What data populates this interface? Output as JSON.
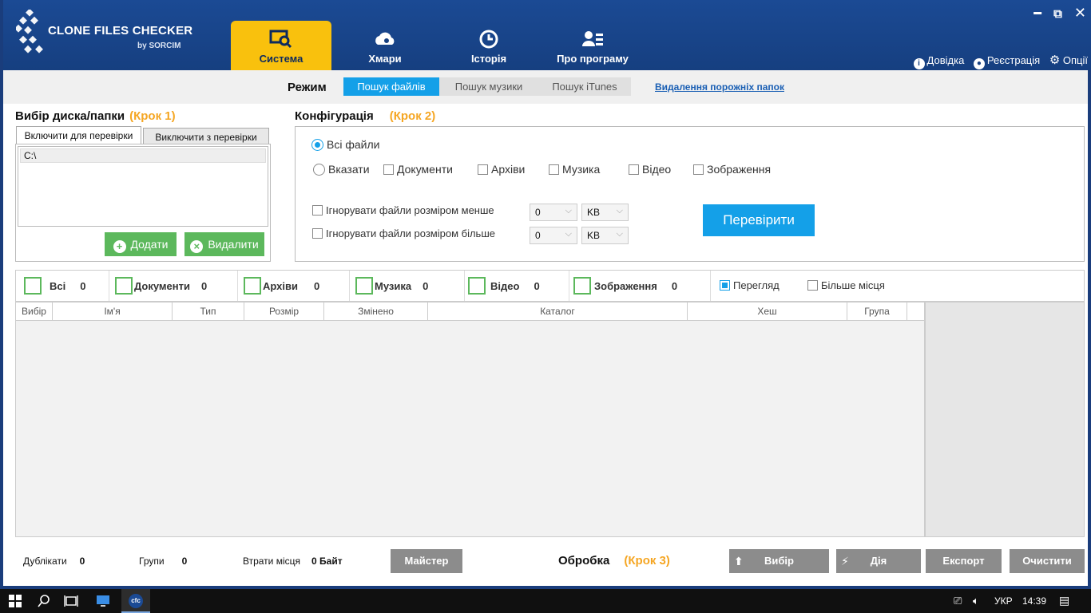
{
  "app": {
    "logo_title": "CLONE FILES CHECKER",
    "logo_sub": "by SORCIM"
  },
  "nav": [
    {
      "label": "Система",
      "icon": "search-drive-icon"
    },
    {
      "label": "Хмари",
      "icon": "cloud-search-icon"
    },
    {
      "label": "Історія",
      "icon": "history-icon"
    },
    {
      "label": "Про програму",
      "icon": "about-icon"
    }
  ],
  "window": {
    "minimize": "▬",
    "restore": "⧉",
    "close": "✕"
  },
  "toplinks": {
    "help": "Довідка",
    "register": "Реєстрація",
    "options": "Опції"
  },
  "mode": {
    "label": "Режим",
    "buttons": [
      "Пошук файлів",
      "Пошук музики",
      "Пошук iTunes"
    ],
    "link": "Видалення порожніх папок"
  },
  "step1": {
    "title": "Вибір диска/папки",
    "step": "(Крок 1)",
    "tabs": [
      "Включити для перевірки",
      "Виключити з перевірки"
    ],
    "paths": [
      "C:\\"
    ],
    "add": "Додати",
    "remove": "Видалити"
  },
  "step2": {
    "title": "Конфігурація",
    "step": "(Крок 2)",
    "all_files": "Всі файли",
    "specify": "Вказати",
    "types": [
      "Документи",
      "Архіви",
      "Музика",
      "Відео",
      "Зображення"
    ],
    "ignore_less": "Ігнорувати файли розміром менше",
    "ignore_more": "Ігнорувати файли розміром більше",
    "size_value": "0",
    "size_unit": "KB",
    "scan": "Перевірити"
  },
  "categories": [
    {
      "label": "Всі",
      "count": "0"
    },
    {
      "label": "Документи",
      "count": "0"
    },
    {
      "label": "Архіви",
      "count": "0"
    },
    {
      "label": "Музика",
      "count": "0"
    },
    {
      "label": "Відео",
      "count": "0"
    },
    {
      "label": "Зображення",
      "count": "0"
    }
  ],
  "preview": "Перегляд",
  "more_space": "Більше місця",
  "columns": [
    "Вибір",
    "Ім'я",
    "Тип",
    "Розмір",
    "Змінено",
    "Каталог",
    "Хеш",
    "Група"
  ],
  "footer": {
    "duplicates_label": "Дублікати",
    "duplicates": "0",
    "groups_label": "Групи",
    "groups": "0",
    "wasted_label": "Втрати місця",
    "wasted": "0 Байт",
    "wizard": "Майстер",
    "process": "Обробка",
    "step": "(Крок 3)",
    "select": "Вибір",
    "action": "Дія",
    "export": "Експорт",
    "clear": "Очистити"
  },
  "taskbar": {
    "app_badge": "cfc",
    "lang": "УКР",
    "time": "14:39"
  },
  "colors": {
    "header": "#163f80",
    "accent": "#f9c10d",
    "blue": "#14a0e8",
    "green": "#5cb85c",
    "step": "#f5a623"
  }
}
